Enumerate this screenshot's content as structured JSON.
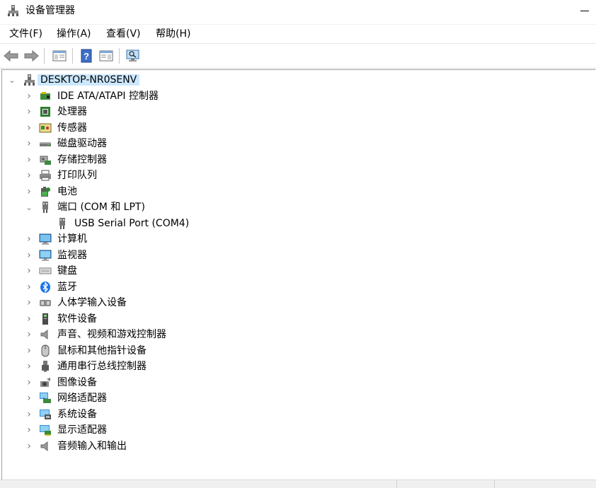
{
  "window": {
    "title": "设备管理器",
    "icon": "device-manager-icon"
  },
  "menu": [
    "文件(F)",
    "操作(A)",
    "查看(V)",
    "帮助(H)"
  ],
  "toolbar": [
    "back-arrow-icon",
    "forward-arrow-icon",
    "show-hide-console-tree-icon",
    "help-icon",
    "properties-pane-icon",
    "scan-hardware-monitor-icon"
  ],
  "tree": {
    "root": {
      "label": "DESKTOP-NR0SENV",
      "icon": "computer-root-icon",
      "expanded": true
    },
    "categories": [
      {
        "label": "IDE ATA/ATAPI 控制器",
        "icon": "ide-controller-icon"
      },
      {
        "label": "处理器",
        "icon": "processor-icon"
      },
      {
        "label": "传感器",
        "icon": "sensor-icon"
      },
      {
        "label": "磁盘驱动器",
        "icon": "disk-drive-icon"
      },
      {
        "label": "存储控制器",
        "icon": "storage-controller-icon"
      },
      {
        "label": "打印队列",
        "icon": "printer-icon"
      },
      {
        "label": "电池",
        "icon": "battery-icon"
      },
      {
        "label": "端口 (COM 和 LPT)",
        "icon": "port-icon",
        "expanded": true,
        "children": [
          {
            "label": "USB Serial Port (COM4)",
            "icon": "port-icon"
          }
        ]
      },
      {
        "label": "计算机",
        "icon": "computer-icon"
      },
      {
        "label": "监视器",
        "icon": "monitor-icon"
      },
      {
        "label": "键盘",
        "icon": "keyboard-icon"
      },
      {
        "label": "蓝牙",
        "icon": "bluetooth-icon"
      },
      {
        "label": "人体学输入设备",
        "icon": "hid-icon"
      },
      {
        "label": "软件设备",
        "icon": "software-device-icon"
      },
      {
        "label": "声音、视频和游戏控制器",
        "icon": "speaker-icon"
      },
      {
        "label": "鼠标和其他指针设备",
        "icon": "mouse-icon"
      },
      {
        "label": "通用串行总线控制器",
        "icon": "usb-icon"
      },
      {
        "label": "图像设备",
        "icon": "camera-icon"
      },
      {
        "label": "网络适配器",
        "icon": "network-adapter-icon"
      },
      {
        "label": "系统设备",
        "icon": "system-device-icon"
      },
      {
        "label": "显示适配器",
        "icon": "display-adapter-icon"
      },
      {
        "label": "音频输入和输出",
        "icon": "audio-io-icon"
      }
    ]
  },
  "colors": {
    "selection": "#cce8ff",
    "expander": "#7a7a7a",
    "border": "#a0a0a0"
  }
}
